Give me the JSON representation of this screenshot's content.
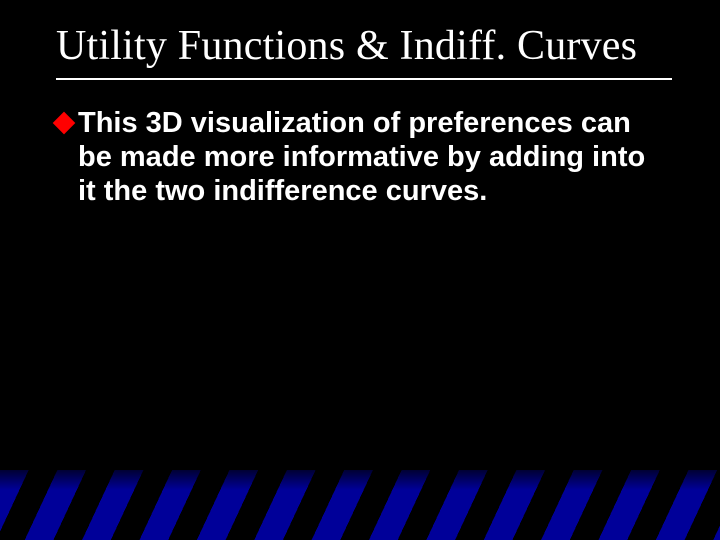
{
  "title": "Utility Functions & Indiff. Curves",
  "bullets": [
    {
      "text": "This 3D visualization of preferences can be made more informative by adding into it the two indifference curves."
    }
  ],
  "colors": {
    "bullet": "#ff0000",
    "stripe": "#000099",
    "bg": "#000000",
    "text": "#ffffff"
  }
}
